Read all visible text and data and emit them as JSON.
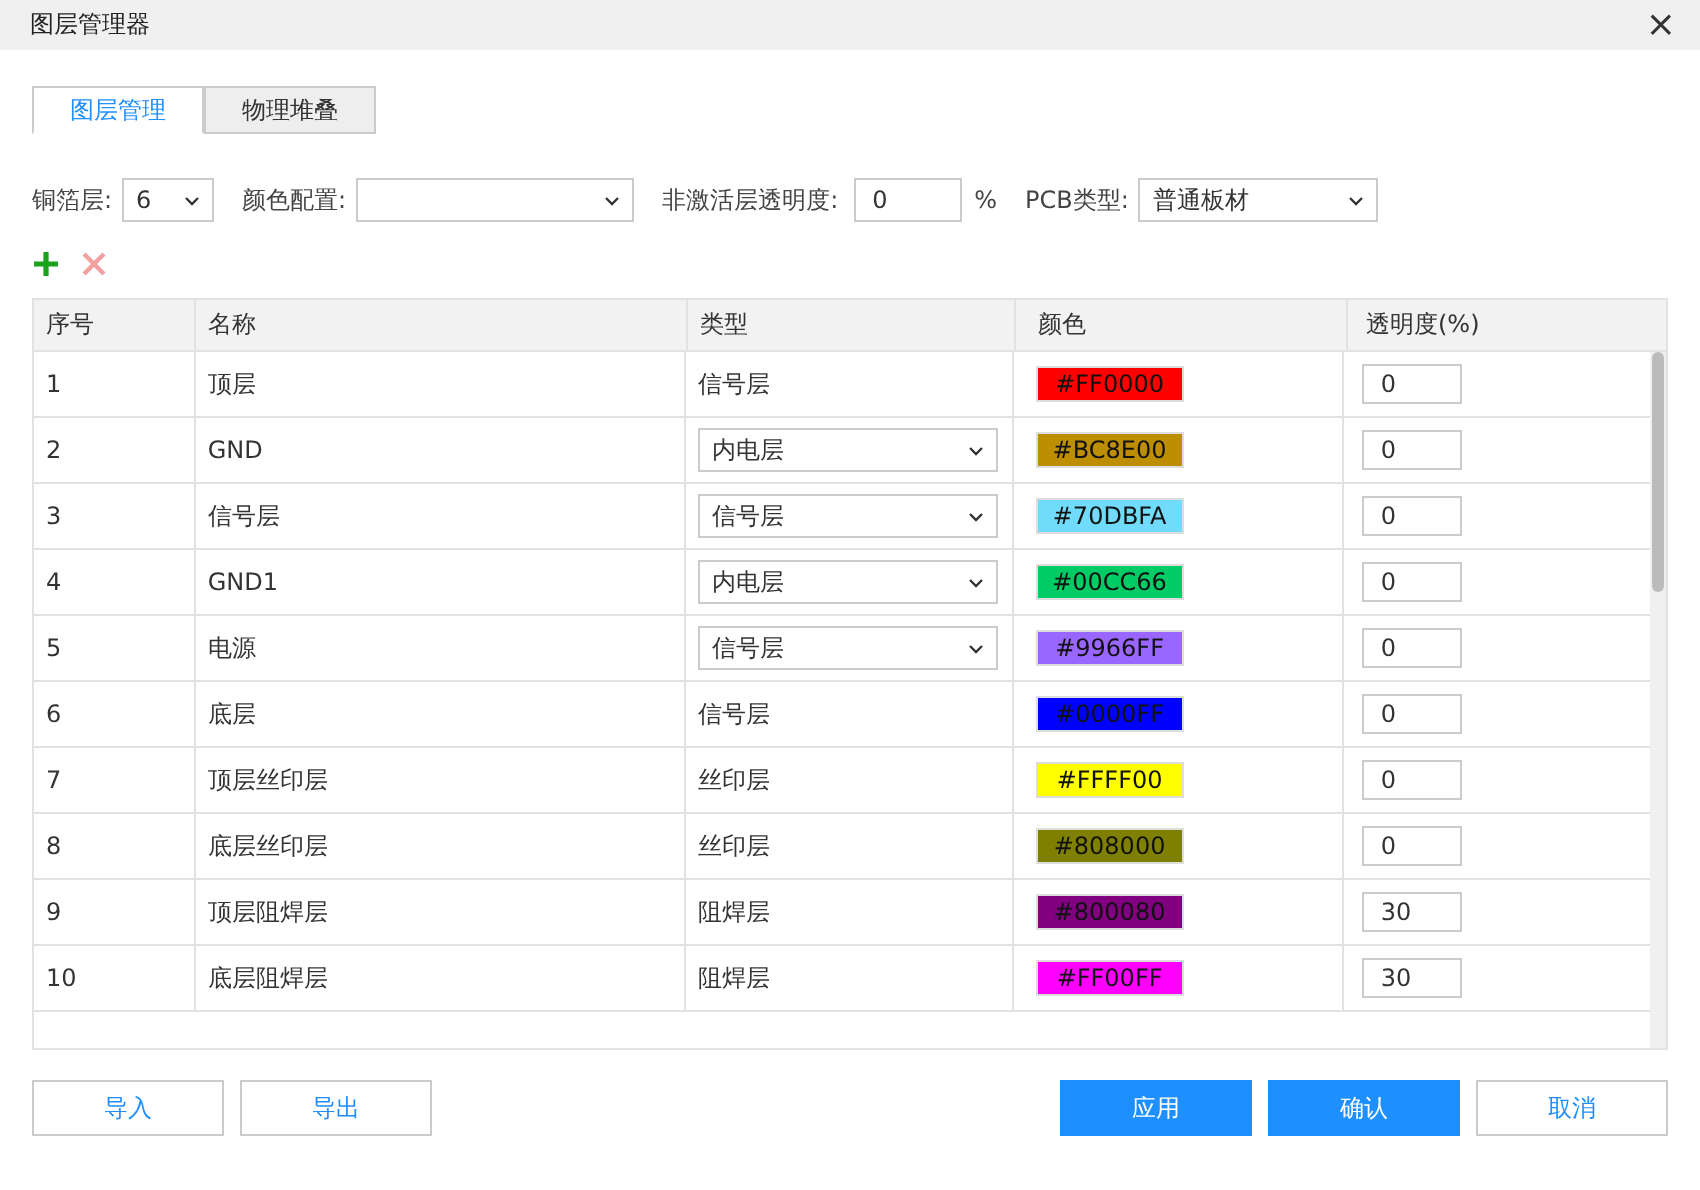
{
  "window": {
    "title": "图层管理器",
    "close": "×"
  },
  "tabs": [
    {
      "label": "图层管理",
      "selected": true
    },
    {
      "label": "物理堆叠",
      "selected": false
    }
  ],
  "settings": {
    "copper_label": "铜箔层:",
    "copper_value": "6",
    "color_label": "颜色配置:",
    "opacity_label": "非激活层透明度:",
    "opacity_value": "0",
    "opacity_unit": "%",
    "pcb_label": "PCB类型:",
    "pcb_value": "普通板材"
  },
  "table": {
    "columns": [
      "序号",
      "名称",
      "类型",
      "颜色",
      "透明度(%)"
    ],
    "rows": [
      {
        "index": "1",
        "name": "顶层",
        "kind": "text",
        "type": "信号层",
        "color": "#ff0000",
        "color_label": "#FF0000",
        "opacity": "0"
      },
      {
        "index": "2",
        "name": "GND",
        "kind": "select",
        "type": "内电层",
        "color": "#bc8e00",
        "color_label": "#BC8E00",
        "opacity": "0"
      },
      {
        "index": "3",
        "name": "信号层",
        "kind": "select",
        "type": "信号层",
        "color": "#70dbfa",
        "color_label": "#70DBFA",
        "opacity": "0"
      },
      {
        "index": "4",
        "name": "GND1",
        "kind": "select",
        "type": "内电层",
        "color": "#00cc66",
        "color_label": "#00CC66",
        "opacity": "0"
      },
      {
        "index": "5",
        "name": "电源",
        "kind": "select",
        "type": "信号层",
        "color": "#9966ff",
        "color_label": "#9966FF",
        "opacity": "0"
      },
      {
        "index": "6",
        "name": "底层",
        "kind": "text",
        "type": "信号层",
        "color": "#0000ff",
        "color_label": "#0000FF",
        "opacity": "0"
      },
      {
        "index": "7",
        "name": "顶层丝印层",
        "kind": "text",
        "type": "丝印层",
        "color": "#ffff00",
        "color_label": "#FFFF00",
        "opacity": "0"
      },
      {
        "index": "8",
        "name": "底层丝印层",
        "kind": "text",
        "type": "丝印层",
        "color": "#808000",
        "color_label": "#808000",
        "opacity": "0"
      },
      {
        "index": "9",
        "name": "顶层阻焊层",
        "kind": "text",
        "type": "阻焊层",
        "color": "#800080",
        "color_label": "#800080",
        "opacity": "30"
      },
      {
        "index": "10",
        "name": "底层阻焊层",
        "kind": "text",
        "type": "阻焊层",
        "color": "#ff00ff",
        "color_label": "#FF00FF",
        "opacity": "30"
      }
    ]
  },
  "buttons": {
    "left": [
      "导入",
      "导出"
    ],
    "right": [
      {
        "label": "应用",
        "primary": true
      },
      {
        "label": "确认",
        "primary": true
      },
      {
        "label": "取消",
        "primary": false
      }
    ]
  }
}
